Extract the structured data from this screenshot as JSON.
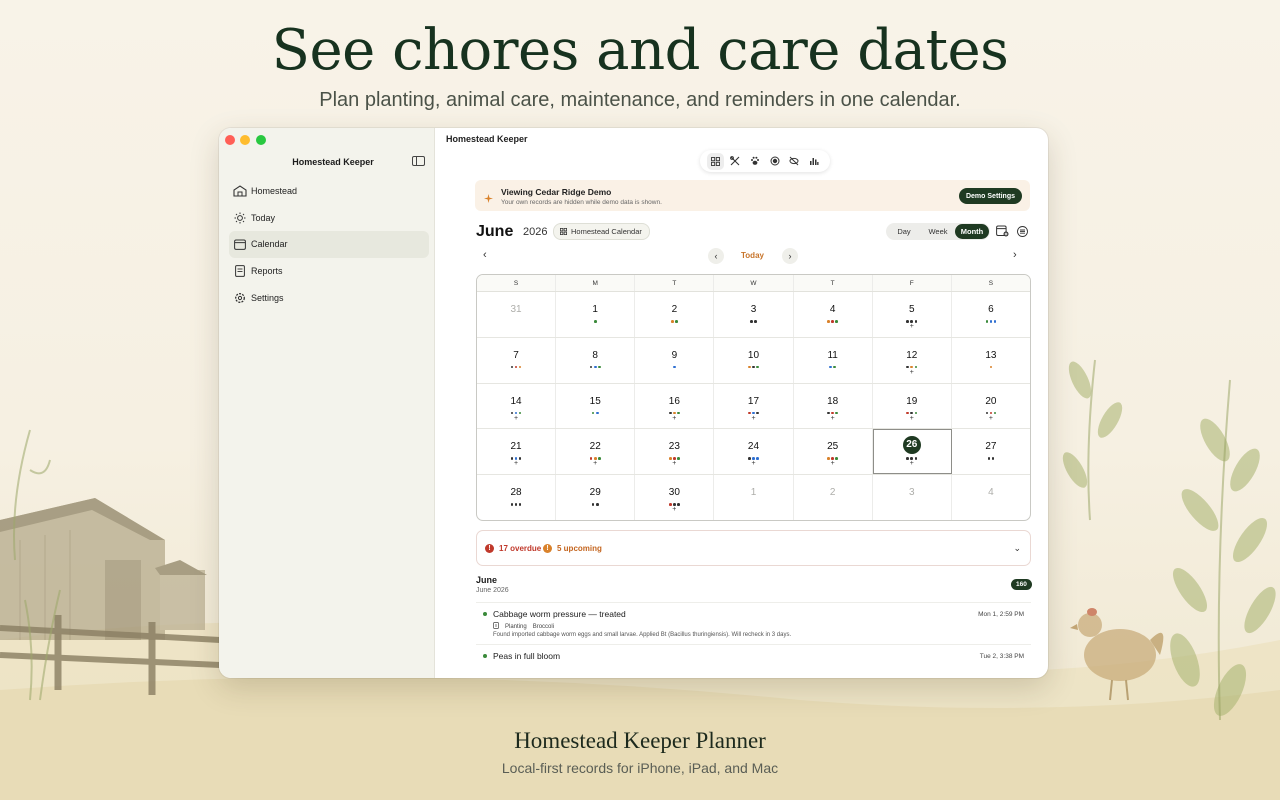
{
  "marketing": {
    "headline": "See chores and care dates",
    "subheadline": "Plan planting, animal care, maintenance, and reminders in one calendar.",
    "footer_title": "Homestead Keeper Planner",
    "footer_subtitle": "Local-first records for iPhone, iPad, and Mac"
  },
  "window": {
    "title": "Homestead Keeper"
  },
  "sidebar": {
    "title": "Homestead Keeper",
    "items": [
      {
        "label": "Homestead",
        "icon": "barn-icon",
        "active": false
      },
      {
        "label": "Today",
        "icon": "sun-icon",
        "active": false
      },
      {
        "label": "Calendar",
        "icon": "calendar-icon",
        "active": true
      },
      {
        "label": "Reports",
        "icon": "report-icon",
        "active": false
      },
      {
        "label": "Settings",
        "icon": "gear-icon",
        "active": false
      }
    ]
  },
  "toolbar": {
    "icons": [
      "grid-icon",
      "tools-icon",
      "paw-icon",
      "record-icon",
      "eye-slash-icon",
      "chart-icon"
    ]
  },
  "demo_banner": {
    "title": "Viewing Cedar Ridge Demo",
    "subtitle": "Your own records are hidden while demo data is shown.",
    "button": "Demo Settings"
  },
  "calendar": {
    "month": "June",
    "year": "2026",
    "chip": "Homestead Calendar",
    "views": [
      "Day",
      "Week",
      "Month"
    ],
    "active_view": "Month",
    "today_label": "Today",
    "weekdays": [
      "S",
      "M",
      "T",
      "W",
      "T",
      "F",
      "S"
    ],
    "weeks": [
      [
        {
          "d": "31",
          "muted": true,
          "dots": [],
          "plus": false
        },
        {
          "d": "1",
          "dots": [
            "#3b8a3b"
          ],
          "plus": false
        },
        {
          "d": "2",
          "dots": [
            "#d9822b",
            "#3b8a3b"
          ],
          "plus": false
        },
        {
          "d": "3",
          "dots": [
            "#333333",
            "#333333"
          ],
          "plus": false
        },
        {
          "d": "4",
          "dots": [
            "#d9822b",
            "#c0392b",
            "#3b8a3b"
          ],
          "plus": false
        },
        {
          "d": "5",
          "dots": [
            "#333333",
            "#333333",
            "#333333"
          ],
          "plus": true
        },
        {
          "d": "6",
          "dots": [
            "#3b8a3b",
            "#2f6fd1",
            "#2f6fd1"
          ],
          "plus": false
        }
      ],
      [
        {
          "d": "7",
          "dots": [
            "#333333",
            "#c0392b",
            "#d9822b"
          ],
          "plus": false
        },
        {
          "d": "8",
          "dots": [
            "#333333",
            "#2f6fd1",
            "#3b8a3b"
          ],
          "plus": false
        },
        {
          "d": "9",
          "dots": [
            "#2f6fd1"
          ],
          "plus": false
        },
        {
          "d": "10",
          "dots": [
            "#d9822b",
            "#333333",
            "#3b8a3b"
          ],
          "plus": false
        },
        {
          "d": "11",
          "dots": [
            "#2f6fd1",
            "#3b8a3b"
          ],
          "plus": false
        },
        {
          "d": "12",
          "dots": [
            "#333333",
            "#d9822b",
            "#3b8a3b"
          ],
          "plus": true
        },
        {
          "d": "13",
          "dots": [
            "#d9822b"
          ],
          "plus": false
        }
      ],
      [
        {
          "d": "14",
          "dots": [
            "#333333",
            "#2f6fd1",
            "#3b8a3b"
          ],
          "plus": true
        },
        {
          "d": "15",
          "dots": [
            "#3b8a3b",
            "#2f6fd1"
          ],
          "plus": false
        },
        {
          "d": "16",
          "dots": [
            "#333333",
            "#d9822b",
            "#3b8a3b"
          ],
          "plus": true
        },
        {
          "d": "17",
          "dots": [
            "#c0392b",
            "#2f6fd1",
            "#333333"
          ],
          "plus": true
        },
        {
          "d": "18",
          "dots": [
            "#333333",
            "#c0392b",
            "#3b8a3b"
          ],
          "plus": true
        },
        {
          "d": "19",
          "dots": [
            "#c0392b",
            "#333333",
            "#3b8a3b"
          ],
          "plus": true
        },
        {
          "d": "20",
          "dots": [
            "#333333",
            "#c0392b",
            "#3b8a3b"
          ],
          "plus": true
        }
      ],
      [
        {
          "d": "21",
          "dots": [
            "#333333",
            "#2f6fd1",
            "#333333"
          ],
          "plus": true
        },
        {
          "d": "22",
          "dots": [
            "#c0392b",
            "#d9822b",
            "#3b8a3b"
          ],
          "plus": true
        },
        {
          "d": "23",
          "dots": [
            "#d9822b",
            "#c0392b",
            "#3b8a3b"
          ],
          "plus": true
        },
        {
          "d": "24",
          "dots": [
            "#333333",
            "#2f6fd1",
            "#2f6fd1"
          ],
          "plus": true
        },
        {
          "d": "25",
          "dots": [
            "#d9822b",
            "#c0392b",
            "#3b8a3b"
          ],
          "plus": true
        },
        {
          "d": "26",
          "today": true,
          "dots": [
            "#333333",
            "#333333",
            "#333333"
          ],
          "plus": true
        },
        {
          "d": "27",
          "dots": [
            "#333333",
            "#333333"
          ],
          "plus": false
        }
      ],
      [
        {
          "d": "28",
          "dots": [
            "#333333",
            "#333333",
            "#333333"
          ],
          "plus": false
        },
        {
          "d": "29",
          "dots": [
            "#333333",
            "#333333"
          ],
          "plus": false
        },
        {
          "d": "30",
          "dots": [
            "#c0392b",
            "#333333",
            "#333333"
          ],
          "plus": true
        },
        {
          "d": "1",
          "muted": true,
          "dots": [],
          "plus": false
        },
        {
          "d": "2",
          "muted": true,
          "dots": [],
          "plus": false
        },
        {
          "d": "3",
          "muted": true,
          "dots": [],
          "plus": false
        },
        {
          "d": "4",
          "muted": true,
          "dots": [],
          "plus": false
        }
      ]
    ]
  },
  "summary": {
    "overdue": "17 overdue",
    "upcoming": "5 upcoming",
    "overdue_color": "#c0392b",
    "upcoming_color": "#d9822b"
  },
  "records": {
    "heading": "June",
    "subheading": "June 2026",
    "count": "160",
    "entries": [
      {
        "title": "Cabbage worm pressure — treated",
        "time": "Mon 1, 2:59 PM",
        "tag_category": "Planting",
        "tag_crop": "Broccoli",
        "description": "Found imported cabbage worm eggs and small larvae. Applied Bt (Bacillus thuringiensis). Will recheck in 3 days."
      },
      {
        "title": "Peas in full bloom",
        "time": "Tue 2, 3:38 PM"
      }
    ]
  },
  "colors": {
    "accent": "#1f3a22",
    "today_text": "#c7742a"
  }
}
